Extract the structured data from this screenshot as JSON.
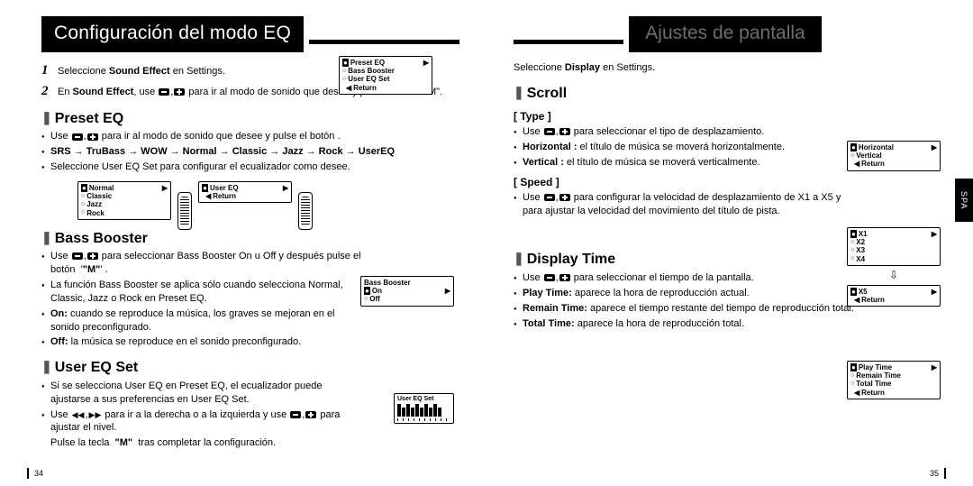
{
  "left": {
    "title": "Configuración del modo EQ",
    "step1": "Seleccione <b>Sound Effect</b> en Settings.",
    "step2": "En <b>Sound Effect</b>, use <span class='minus'></span>,<span class='plus'></span> para ir al modo de sonido que desee y pulse el botón \"M\".",
    "fig_top": {
      "rows": [
        "Preset EQ",
        "Bass Booster",
        "User EQ Set",
        "Return"
      ],
      "sel": 0,
      "return_idx": 3
    },
    "preset_eq": {
      "h": "Preset EQ",
      "bullets": [
        "Use <span class='minus'></span>,<span class='plus'></span> para ir al modo de sonido que desee y pulse el botón .",
        "<b>SRS → TruBass → WOW → Normal → Classic → Jazz → Rock → UserEQ</b>",
        "Seleccione User EQ Set para configurar el ecualizador como desee."
      ],
      "lcd_a": {
        "rows": [
          "Normal",
          "Classic",
          "Jazz",
          "Rock"
        ],
        "sel": 0
      },
      "lcd_b": {
        "rows": [
          "User EQ",
          "Return"
        ],
        "sel": 0,
        "return_idx": 1
      }
    },
    "bass": {
      "h": "Bass Booster",
      "bullets": [
        "Use <span class='minus'></span>,<span class='plus'></span> para seleccionar Bass Booster On u Off y después pulse el botón &nbsp;'<b>\"M\"</b>' .",
        "La función Bass Booster se aplica sólo cuando selecciona Normal, Classic, Jazz o Rock en Preset EQ.",
        "<b>On:</b> cuando se reproduce la música, los graves se mejoran en el sonido preconfigurado.",
        "<b>Off:</b> la música se reproduce en el sonido preconfigurado."
      ],
      "lcd": {
        "title": "Bass Booster",
        "rows": [
          "On",
          "Off"
        ],
        "sel": 0
      }
    },
    "usereq": {
      "h": "User EQ Set",
      "bullets": [
        "Si se selecciona User EQ en Preset EQ, el ecualizador puede ajustarse a sus preferencias en User EQ Set.",
        "Use <span class='rew'>&#9664;&#9664;</span>,<span class='fwd'>&#9654;&#9654;</span> para ir a la derecha o a la izquierda y use <span class='minus'></span>,<span class='plus'></span> para ajustar el nivel."
      ],
      "tail": "Pulse la tecla &nbsp;<b>\"M\"</b>&nbsp; tras completar la configuración.",
      "lcd_title": "User EQ Set"
    },
    "pagenum": "34"
  },
  "right": {
    "title": "Ajustes de pantalla",
    "intro": "Seleccione <b>Display</b> en Settings.",
    "scroll": {
      "h": "Scroll",
      "type": {
        "h": "Type",
        "bullets": [
          "Use <span class='minus'></span>,<span class='plus'></span> para seleccionar el tipo de desplazamiento.",
          "<b>Horizontal :</b> el título de música se moverá horizontalmente.",
          "<b>Vertical :</b> el título de música se moverá verticalmente."
        ],
        "lcd": {
          "rows": [
            "Horizontal",
            "Vertical",
            "Return"
          ],
          "sel": 0,
          "return_idx": 2
        }
      },
      "speed": {
        "h": "Speed",
        "bullets": [
          "Use <span class='minus'></span>,<span class='plus'></span> para configurar la velocidad de desplazamiento de X1 a X5 y para ajustar la velocidad del movimiento del título de pista."
        ],
        "lcd_a": {
          "rows": [
            "X1",
            "X2",
            "X3",
            "X4"
          ],
          "sel": 0
        },
        "lcd_b": {
          "rows": [
            "X5",
            "Return"
          ],
          "sel": 0,
          "return_idx": 1
        }
      }
    },
    "dtime": {
      "h": "Display Time",
      "bullets": [
        "Use <span class='minus'></span>,<span class='plus'></span> para seleccionar el tiempo de la pantalla.",
        "<b>Play Time:</b> aparece la hora de reproducción actual.",
        "<b>Remain Time:</b> aparece el tiempo restante del tiempo de reproducción total.",
        "<b>Total Time:</b> aparece la hora de reproducción total."
      ],
      "lcd": {
        "rows": [
          "Play Time",
          "Remain Time",
          "Total Time",
          "Return"
        ],
        "sel": 0,
        "return_idx": 3
      }
    },
    "side_tab": "SPA",
    "pagenum": "35"
  }
}
